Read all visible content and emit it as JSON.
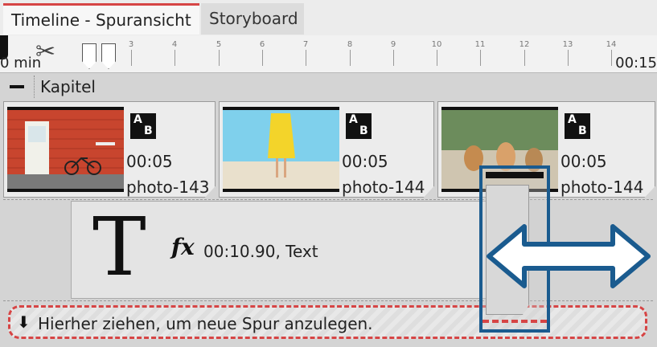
{
  "tabs": [
    {
      "label": "Timeline - Spuransicht",
      "active": true
    },
    {
      "label": "Storyboard",
      "active": false
    }
  ],
  "ruler": {
    "ticks": [
      "3",
      "4",
      "5",
      "6",
      "7",
      "8",
      "9",
      "10",
      "11",
      "12",
      "13",
      "14"
    ],
    "time_left": "0 min",
    "time_right": "00:15"
  },
  "chapter": {
    "title": "Kapitel"
  },
  "clips": [
    {
      "duration": "00:05",
      "name": "photo-143"
    },
    {
      "duration": "00:05",
      "name": "photo-144"
    },
    {
      "duration": "00:05",
      "name": "photo-144"
    }
  ],
  "transition_icon": {
    "a": "A",
    "b": "B"
  },
  "text_clip": {
    "glyph": "T",
    "fx_icon": "fx",
    "info": "00:10.90, Text"
  },
  "drop_zone": {
    "label": "Hierher ziehen, um neue Spur anzulegen."
  },
  "colors": {
    "accent": "#d64545",
    "highlight": "#1a5b8f",
    "arrow_fill": "#ffffff"
  },
  "icons": {
    "scissors": "scissors-icon",
    "marker": "marker-icon",
    "resize": "resize-arrow-icon",
    "drop": "arrow-down-icon"
  }
}
